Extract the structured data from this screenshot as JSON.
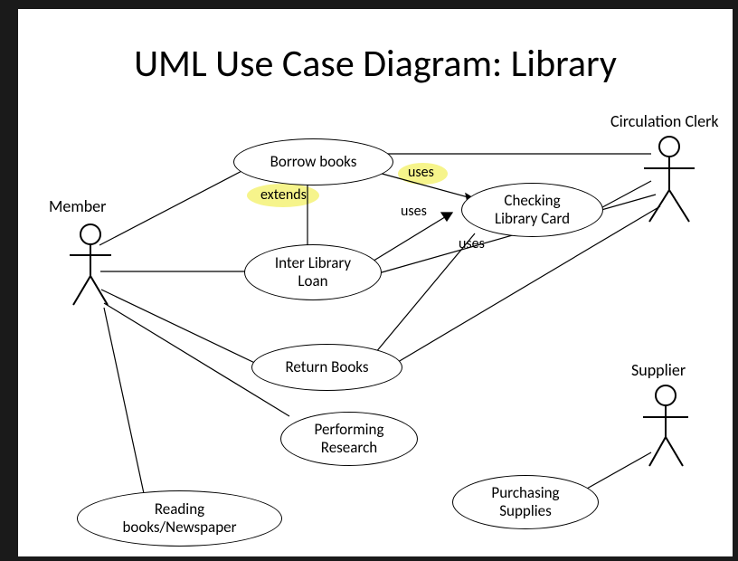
{
  "title": "UML Use Case Diagram: Library",
  "actors": {
    "member": "Member",
    "clerk": "Circulation Clerk",
    "supplier": "Supplier"
  },
  "usecases": {
    "borrow": "Borrow books",
    "checking": "Checking\nLibrary Card",
    "interlib": "Inter Library\nLoan",
    "return": "Return Books",
    "research": "Performing\nResearch",
    "reading": "Reading\nbooks/Newspaper",
    "purchasing": "Purchasing\nSupplies"
  },
  "rels": {
    "extends": "extends",
    "uses1": "uses",
    "uses2": "uses",
    "uses3": "uses"
  },
  "chart_data": {
    "type": "uml-use-case",
    "title": "UML Use Case Diagram: Library",
    "actors": [
      "Member",
      "Circulation Clerk",
      "Supplier"
    ],
    "use_cases": [
      "Borrow books",
      "Checking Library Card",
      "Inter Library Loan",
      "Return Books",
      "Performing Research",
      "Reading books/Newspaper",
      "Purchasing Supplies"
    ],
    "associations": [
      {
        "actor": "Member",
        "use_case": "Borrow books"
      },
      {
        "actor": "Member",
        "use_case": "Inter Library Loan"
      },
      {
        "actor": "Member",
        "use_case": "Return Books"
      },
      {
        "actor": "Member",
        "use_case": "Performing Research"
      },
      {
        "actor": "Member",
        "use_case": "Reading books/Newspaper"
      },
      {
        "actor": "Circulation Clerk",
        "use_case": "Borrow books"
      },
      {
        "actor": "Circulation Clerk",
        "use_case": "Checking Library Card"
      },
      {
        "actor": "Circulation Clerk",
        "use_case": "Inter Library Loan"
      },
      {
        "actor": "Circulation Clerk",
        "use_case": "Return Books"
      },
      {
        "actor": "Supplier",
        "use_case": "Purchasing Supplies"
      }
    ],
    "relationships": [
      {
        "from": "Inter Library Loan",
        "to": "Borrow books",
        "type": "extends"
      },
      {
        "from": "Borrow books",
        "to": "Checking Library Card",
        "type": "uses"
      },
      {
        "from": "Inter Library Loan",
        "to": "Checking Library Card",
        "type": "uses"
      },
      {
        "from": "Return Books",
        "to": "Checking Library Card",
        "type": "uses"
      }
    ],
    "highlighted_labels": [
      "extends",
      "uses"
    ]
  }
}
